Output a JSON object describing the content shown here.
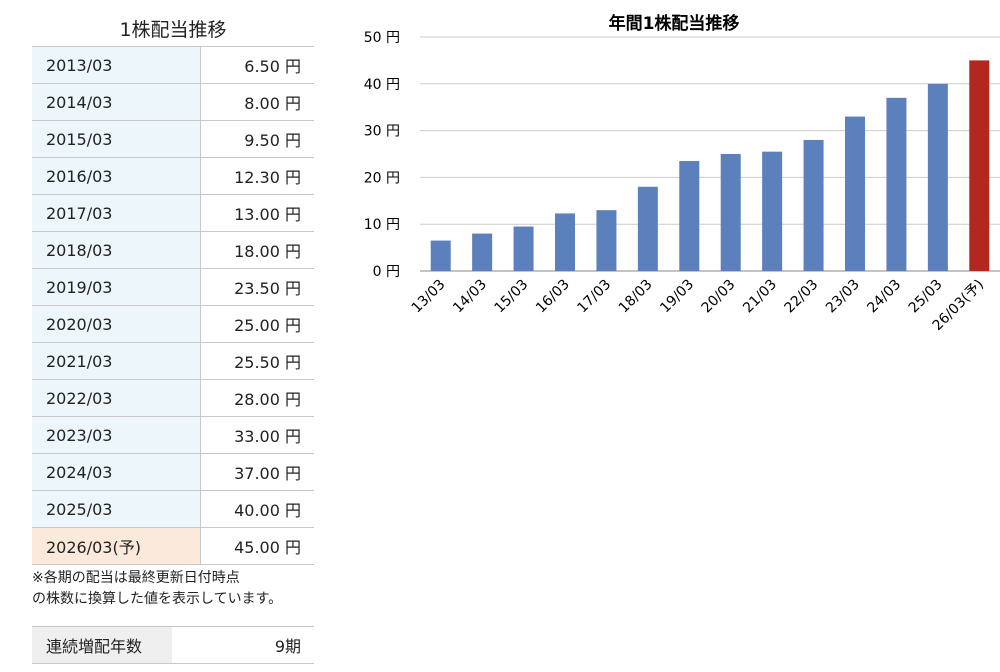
{
  "dividend_table": {
    "title": "1株配当推移",
    "rows": [
      {
        "period": "2013/03",
        "amount": "6.50 円"
      },
      {
        "period": "2014/03",
        "amount": "8.00 円"
      },
      {
        "period": "2015/03",
        "amount": "9.50 円"
      },
      {
        "period": "2016/03",
        "amount": "12.30 円"
      },
      {
        "period": "2017/03",
        "amount": "13.00 円"
      },
      {
        "period": "2018/03",
        "amount": "18.00 円"
      },
      {
        "period": "2019/03",
        "amount": "23.50 円"
      },
      {
        "period": "2020/03",
        "amount": "25.00 円"
      },
      {
        "period": "2021/03",
        "amount": "25.50 円"
      },
      {
        "period": "2022/03",
        "amount": "28.00 円"
      },
      {
        "period": "2023/03",
        "amount": "33.00 円"
      },
      {
        "period": "2024/03",
        "amount": "37.00 円"
      },
      {
        "period": "2025/03",
        "amount": "40.00 円"
      },
      {
        "period": "2026/03(予)",
        "amount": "45.00 円",
        "forecast": true
      }
    ],
    "note_line1": "※各期の配当は最終更新日付時点",
    "note_line2": "の株数に換算した値を表示しています。"
  },
  "streak": {
    "label": "連続増配年数",
    "value": "9期"
  },
  "colors": {
    "bar": "#5b80bc",
    "forecast_bar": "#b3271e",
    "row_bg": "#edf6fa",
    "forecast_row_bg": "#fbeadb"
  },
  "chart_data": {
    "type": "bar",
    "title": "年間1株配当推移",
    "categories": [
      "13/03",
      "14/03",
      "15/03",
      "16/03",
      "17/03",
      "18/03",
      "19/03",
      "20/03",
      "21/03",
      "22/03",
      "23/03",
      "24/03",
      "25/03",
      "26/03(予)"
    ],
    "values": [
      6.5,
      8.0,
      9.5,
      12.3,
      13.0,
      18.0,
      23.5,
      25.0,
      25.5,
      28.0,
      33.0,
      37.0,
      40.0,
      45.0
    ],
    "highlight_last": true,
    "ylim": [
      0,
      50
    ],
    "yticks": [
      0,
      10,
      20,
      30,
      40,
      50
    ],
    "ytick_suffix": " 円",
    "grid": true
  }
}
